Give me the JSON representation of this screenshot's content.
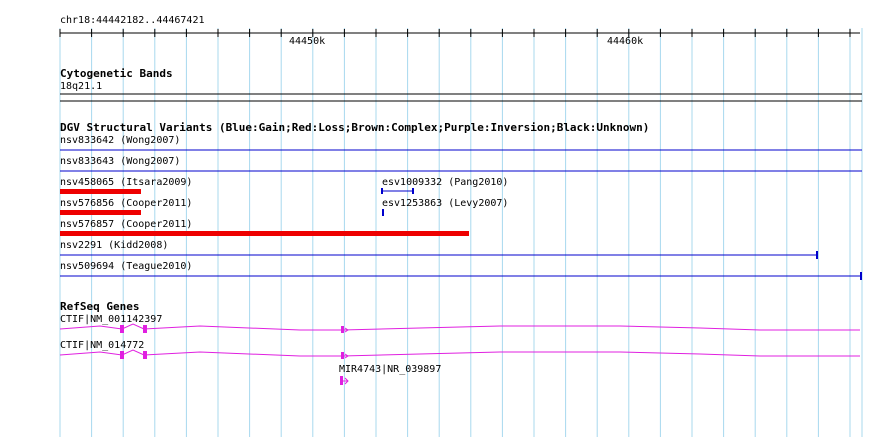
{
  "ruler": {
    "coords": "chr18:44442182..44467421",
    "ticks": [
      "44450k",
      "44460k"
    ]
  },
  "tracks": {
    "cytogenetic": {
      "title": "Cytogenetic Bands",
      "band_label": "18q21.1"
    },
    "dgv": {
      "title": "DGV Structural Variants (Blue:Gain;Red:Loss;Brown:Complex;Purple:Inversion;Black:Unknown)",
      "items": [
        {
          "label": "nsv833642 (Wong2007)",
          "type": "gain"
        },
        {
          "label": "nsv833643 (Wong2007)",
          "type": "gain"
        },
        {
          "label": "nsv458065 (Itsara2009)",
          "type": "loss"
        },
        {
          "label": "esv1009332 (Pang2010)",
          "type": "gain"
        },
        {
          "label": "nsv576856 (Cooper2011)",
          "type": "loss"
        },
        {
          "label": "esv1253863 (Levy2007)",
          "type": "gain"
        },
        {
          "label": "nsv576857 (Cooper2011)",
          "type": "loss"
        },
        {
          "label": "nsv2291 (Kidd2008)",
          "type": "gain"
        },
        {
          "label": "nsv509694 (Teague2010)",
          "type": "gain"
        }
      ]
    },
    "refseq": {
      "title": "RefSeq Genes",
      "genes": [
        {
          "label": "CTIF|NM_001142397"
        },
        {
          "label": "CTIF|NM_014772"
        },
        {
          "label": "MIR4743|NR_039897"
        }
      ]
    }
  },
  "colors": {
    "grid": "#a8d8ee",
    "gain": "#0000cc",
    "loss": "#ee0000",
    "gene": "#e020e0",
    "ruler": "#000000"
  }
}
